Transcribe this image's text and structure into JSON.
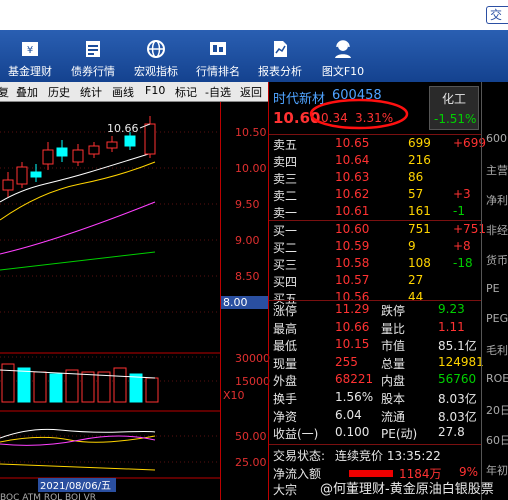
{
  "titlebar": {
    "btn": "交"
  },
  "toolbar": [
    {
      "label": "基金理财",
      "icon": "fund-icon"
    },
    {
      "label": "债券行情",
      "icon": "bond-icon"
    },
    {
      "label": "宏观指标",
      "icon": "globe-icon"
    },
    {
      "label": "行情排名",
      "icon": "ranking-icon"
    },
    {
      "label": "报表分析",
      "icon": "report-icon"
    },
    {
      "label": "图文F10",
      "icon": "service-icon"
    }
  ],
  "subbar": [
    "复",
    "叠加",
    "历史",
    "统计",
    "画线",
    "F10",
    "标记",
    "-自选",
    "返回"
  ],
  "chart": {
    "type": "line",
    "title": "",
    "high_label": "10.66",
    "date_label": "2021/08/06/五",
    "cursor_value": "8.00",
    "volume_multiplier": "X10",
    "price_ticks": [
      "10.50",
      "10.00",
      "9.50",
      "9.00",
      "8.50"
    ],
    "volume_ticks": [
      "30000",
      "15000"
    ],
    "indicator_ticks": [
      "50.00",
      "25.00"
    ],
    "colors": {
      "up": "#ff3232",
      "down": "#00ffff",
      "ma5": "#ffffff",
      "ma10": "#ffd400",
      "ma20": "#ff40ff",
      "ma60": "#00d000"
    }
  },
  "quote": {
    "name": "时代新材",
    "code": "600458",
    "index_name": "化工",
    "index_change": "-1.51%",
    "price": "10.60",
    "change": "0.34",
    "change_pct": "3.31%"
  },
  "asks": [
    {
      "label": "卖五",
      "price": "10.65",
      "vol": "699",
      "chg": "+699"
    },
    {
      "label": "卖四",
      "price": "10.64",
      "vol": "216",
      "chg": ""
    },
    {
      "label": "卖三",
      "price": "10.63",
      "vol": "86",
      "chg": ""
    },
    {
      "label": "卖二",
      "price": "10.62",
      "vol": "57",
      "chg": "+3"
    },
    {
      "label": "卖一",
      "price": "10.61",
      "vol": "161",
      "chg": "-1"
    }
  ],
  "bids": [
    {
      "label": "买一",
      "price": "10.60",
      "vol": "751",
      "chg": "+751"
    },
    {
      "label": "买二",
      "price": "10.59",
      "vol": "9",
      "chg": "+8"
    },
    {
      "label": "买三",
      "price": "10.58",
      "vol": "108",
      "chg": "-18"
    },
    {
      "label": "买四",
      "price": "10.57",
      "vol": "27",
      "chg": ""
    },
    {
      "label": "买五",
      "price": "10.56",
      "vol": "44",
      "chg": ""
    }
  ],
  "stats": [
    {
      "l1": "涨停",
      "v1": "11.29",
      "l2": "跌停",
      "v2": "9.23"
    },
    {
      "l1": "最高",
      "v1": "10.66",
      "l2": "量比",
      "v2": "1.11"
    },
    {
      "l1": "最低",
      "v1": "10.15",
      "l2": "市值",
      "v2": "85.1亿"
    },
    {
      "l1": "现量",
      "v1": "255",
      "l2": "总量",
      "v2": "124981"
    },
    {
      "l1": "外盘",
      "v1": "68221",
      "l2": "内盘",
      "v2": "56760"
    },
    {
      "l1": "换手",
      "v1": "1.56%",
      "l2": "股本",
      "v2": "8.03亿"
    },
    {
      "l1": "净资",
      "v1": "6.04",
      "l2": "流通",
      "v2": "8.03亿"
    },
    {
      "l1": "收益(一)",
      "v1": "0.100",
      "l2": "PE(动)",
      "v2": "27.8"
    }
  ],
  "status": {
    "label": "交易状态:",
    "value": "连续竞价 13:35:22"
  },
  "flow": {
    "label": "净流入额",
    "value": "1184万",
    "pct": "9%",
    "label2": "大宗"
  },
  "far": [
    "600",
    "主营",
    "净利",
    "非经",
    "货币",
    "PE",
    "PEG",
    "毛利",
    "ROE",
    "20日",
    "60日",
    "年初"
  ],
  "watermark": "@何董理财-黄金原油白银股票"
}
